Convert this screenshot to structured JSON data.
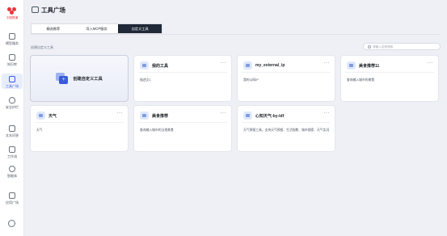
{
  "brand": {
    "logo_text": "中国联通"
  },
  "sidebar": {
    "items": [
      {
        "label": "模型服务",
        "icon": "model-icon"
      },
      {
        "label": "知识库",
        "icon": "knowledge-icon"
      },
      {
        "label": "工具广场",
        "icon": "tools-icon",
        "active": true
      },
      {
        "label": "安全护栏",
        "icon": "shield-icon"
      },
      {
        "label": "文本问答",
        "icon": "document-icon"
      },
      {
        "label": "工作流",
        "icon": "workflow-icon"
      },
      {
        "label": "智能体",
        "icon": "agent-icon"
      },
      {
        "label": "应用广场",
        "icon": "app-icon"
      }
    ],
    "settings_icon": "gear-icon"
  },
  "header": {
    "title": "工具广场"
  },
  "tabs": [
    {
      "label": "精选推荐"
    },
    {
      "label": "导入MCP服务"
    },
    {
      "label": "自定义工具",
      "active": true
    }
  ],
  "section": {
    "label": "创建自定义工具"
  },
  "search": {
    "placeholder": "请输入名称搜索",
    "value": ""
  },
  "create_card": {
    "label": "创建自定义工具"
  },
  "cards": [
    {
      "title": "我的工具",
      "description": "描述文1"
    },
    {
      "title": "my_external_ip",
      "description": "我的公网IP"
    },
    {
      "title": "美食推荐11",
      "description": "查询输入城市的美食"
    },
    {
      "title": "天气",
      "description": "天气"
    },
    {
      "title": "美食推荐",
      "description": "查询输入城市的当地美食"
    },
    {
      "title": "心知天气-by-ldf",
      "description": "天气预报工具，支持天气预报、生活指数、城市搜索、天气实况"
    }
  ],
  "colors": {
    "accent": "#3a5bd9",
    "active_tab_bg": "#1f2937",
    "brand": "#e4393c"
  }
}
